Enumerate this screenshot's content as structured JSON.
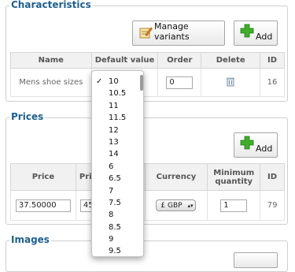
{
  "characteristics": {
    "legend": "Characteristics",
    "buttons": {
      "manage_variants": "Manage variants",
      "add": "Add"
    },
    "columns": [
      "Name",
      "Default value",
      "Order",
      "Delete",
      "ID"
    ],
    "row": {
      "name": "Mens shoe sizes",
      "order": "0",
      "id": "16"
    },
    "dropdown": {
      "selected": "10",
      "options": [
        "10",
        "10.5",
        "11",
        "11.5",
        "12",
        "13",
        "14",
        "6",
        "6.5",
        "7",
        "7.5",
        "8",
        "8.5",
        "9",
        "9.5"
      ]
    }
  },
  "prices": {
    "legend": "Prices",
    "buttons": {
      "add": "Add"
    },
    "columns": [
      "Price",
      "Pri",
      "Currency",
      "Minimum quantity",
      "ID"
    ],
    "row": {
      "price": "37.50000",
      "second_price": "45",
      "currency": "£ GBP",
      "min_qty": "1",
      "id": "79"
    }
  },
  "images": {
    "legend": "Images"
  },
  "colors": {
    "legend": "#1f5f8f",
    "add_icon": "#3fae29"
  }
}
